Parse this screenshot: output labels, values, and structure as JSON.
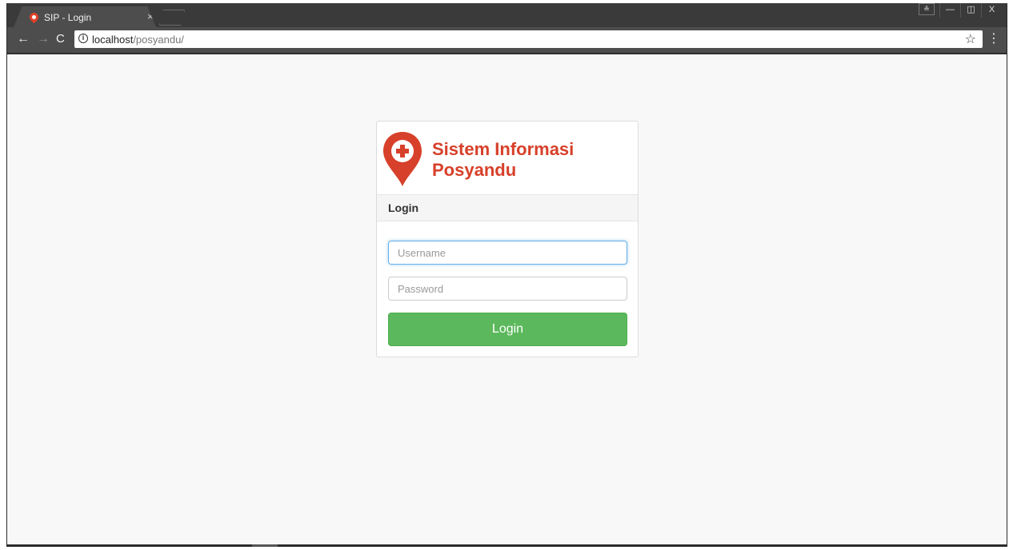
{
  "browser": {
    "tab": {
      "title": "SIP - Login",
      "close_glyph": "×"
    },
    "window_controls": {
      "user": "≗",
      "minimize": "—",
      "restore": "◫",
      "close": "X"
    },
    "nav": {
      "back": "←",
      "forward": "→",
      "reload": "C"
    },
    "address": {
      "host": "localhost",
      "path": "/posyandu/"
    },
    "bookmark_star": "☆",
    "menu": "⋮"
  },
  "login": {
    "brand_line1": "Sistem Informasi",
    "brand_line2": "Posyandu",
    "heading": "Login",
    "username_placeholder": "Username",
    "password_placeholder": "Password",
    "submit_label": "Login"
  },
  "colors": {
    "brand_red": "#d7402a",
    "button_green": "#5cb85c",
    "page_bg": "#f8f8f8"
  }
}
